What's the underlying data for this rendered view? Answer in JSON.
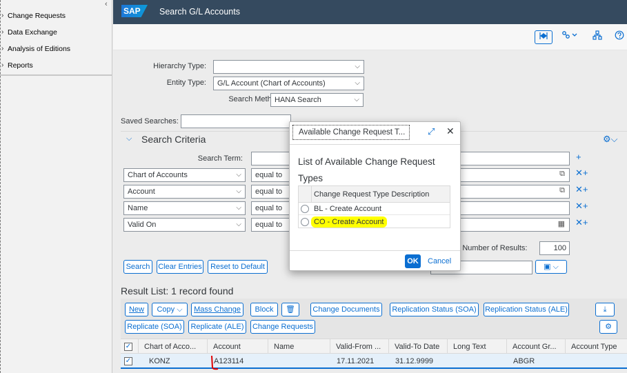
{
  "sidebar": {
    "items": [
      {
        "label": "Change Requests"
      },
      {
        "label": "Data Exchange"
      },
      {
        "label": "Analysis of Editions"
      },
      {
        "label": "Reports"
      }
    ],
    "collapse_glyph": "‹"
  },
  "header": {
    "logo": "SAP",
    "title": "Search G/L Accounts"
  },
  "toolbar": {
    "icons": [
      "collapse-header-icon",
      "share-icon",
      "hierarchy-icon",
      "help-icon"
    ]
  },
  "form": {
    "hierarchy_type_label": "Hierarchy Type:",
    "hierarchy_type_value": "",
    "entity_type_label": "Entity Type:",
    "entity_type_value": "G/L Account (Chart of Accounts)",
    "search_method_label": "Search Method:",
    "search_method_value": "HANA Search",
    "saved_searches_label": "Saved Searches:"
  },
  "criteria": {
    "title": "Search Criteria",
    "search_term_label": "Search Term:",
    "rows": [
      {
        "field": "Chart of Accounts",
        "operator": "equal to"
      },
      {
        "field": "Account",
        "operator": "equal to"
      },
      {
        "field": "Name",
        "operator": "equal to"
      },
      {
        "field": "Valid On",
        "operator": "equal to"
      }
    ],
    "max_results_label": "um Number of Results:",
    "max_results_value": "100",
    "buttons": {
      "search": "Search",
      "clear": "Clear Entries",
      "reset": "Reset to Default"
    }
  },
  "results": {
    "title": "Result List: 1 record found",
    "actions_row1": [
      "New",
      "Copy",
      "Mass Change",
      "Block",
      "Change Documents",
      "Replication Status (SOA)",
      "Replication Status (ALE)"
    ],
    "actions_row2": [
      "Replicate (SOA)",
      "Replicate (ALE)",
      "Change Requests"
    ],
    "columns": [
      "Chart of Acco...",
      "Account",
      "Name",
      "Valid-From ...",
      "Valid-To Date",
      "Long Text",
      "Account Gr...",
      "Account Type"
    ],
    "rows": [
      {
        "chart": "KONZ",
        "account": "A123114",
        "name": "",
        "valid_from": "17.11.2021",
        "valid_to": "31.12.9999",
        "long_text": "",
        "account_group": "ABGR",
        "account_type": ""
      }
    ]
  },
  "dialog": {
    "title": "Available Change Request T...",
    "heading": "List of Available Change Request Types",
    "column": "Change Request Type Description",
    "options": [
      {
        "label": "BL - Create Account",
        "highlighted": false
      },
      {
        "label": "CO - Create Account",
        "highlighted": true
      }
    ],
    "ok_label": "OK",
    "cancel_label": "Cancel"
  },
  "colors": {
    "shell": "#354a5f",
    "accent": "#0a6ed1",
    "highlight": "#ffff00"
  }
}
